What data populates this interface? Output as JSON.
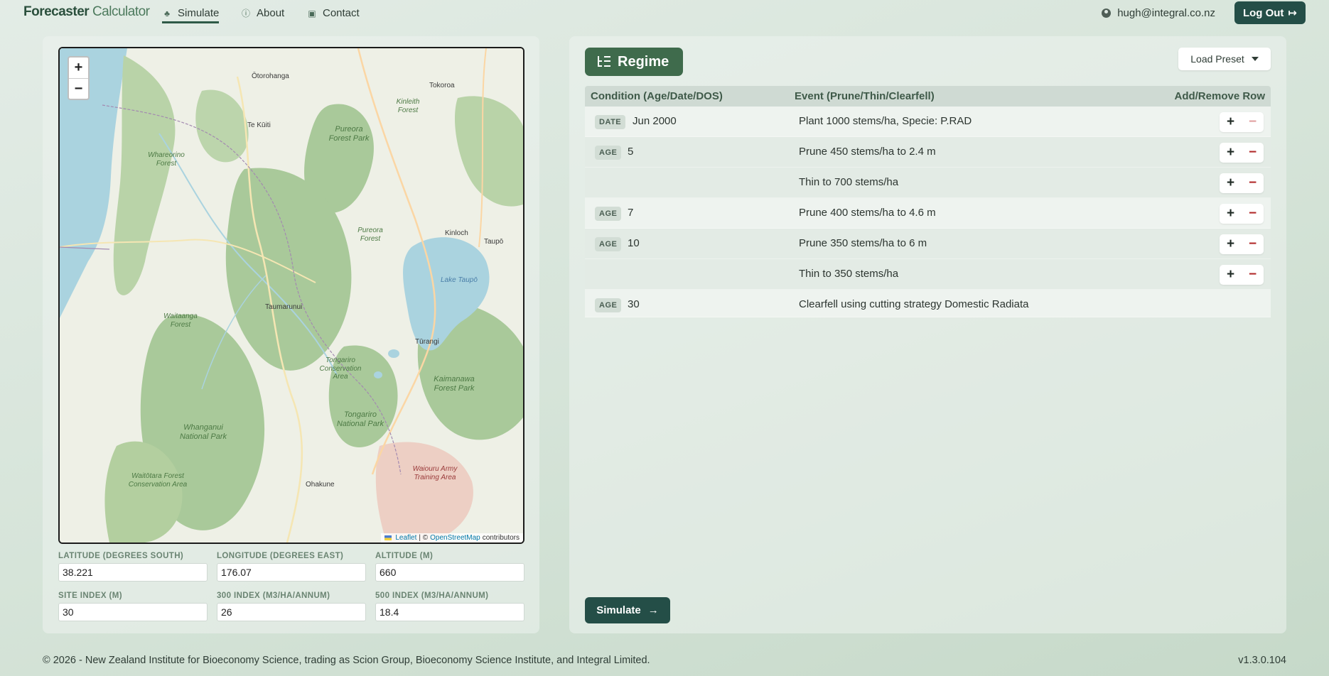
{
  "nav": {
    "brand_main": "Forecaster",
    "brand_accent": "Calculator",
    "links": [
      {
        "label": "Simulate",
        "icon": "tree-icon",
        "glyph": "♣",
        "active": true
      },
      {
        "label": "About",
        "icon": "info-icon",
        "glyph": "ⓘ",
        "active": false
      },
      {
        "label": "Contact",
        "icon": "contact-card-icon",
        "glyph": "▣",
        "active": false
      }
    ],
    "user_email": "hugh@integral.co.nz",
    "logout_label": "Log Out",
    "logout_icon": "↦"
  },
  "map": {
    "zoom_in": "+",
    "zoom_out": "−",
    "attribution": {
      "leaflet": "Leaflet",
      "separator": "| ©",
      "osm": "OpenStreetMap",
      "suffix": "contributors"
    },
    "places": {
      "otorohanga": "Ōtorohanga",
      "tokoroa": "Tokoroa",
      "kinleith": "Kinleith Forest",
      "te_kuiti": "Te Kūiti",
      "pureora_park": "Pureora Forest Park",
      "whareorino": "Whareorino Forest",
      "pureora_forest": "Pureora Forest",
      "kinloch": "Kinloch",
      "taupo": "Taupō",
      "lake_taupo": "Lake Taupō",
      "taumarunui": "Taumarunui",
      "waitaanga": "Waitaanga Forest",
      "turangi": "Tūrangi",
      "tongariro_cons": "Tongariro Conservation Area",
      "kaimanawa": "Kaimanawa Forest Park",
      "tongariro_np": "Tongariro National Park",
      "whanganui": "Whanganui National Park",
      "waiouru": "Waiouru Army Training Area",
      "waitotara": "Waitōtara Forest Conservation Area",
      "ohakune": "Ohakune"
    }
  },
  "fields": {
    "latitude": {
      "label": "Latitude (degrees south)",
      "value": "38.221"
    },
    "longitude": {
      "label": "Longitude (degrees east)",
      "value": "176.07"
    },
    "altitude": {
      "label": "Altitude (m)",
      "value": "660"
    },
    "site_index": {
      "label": "Site Index (m)",
      "value": "30"
    },
    "index_300": {
      "label": "300 Index (m3/ha/annum)",
      "value": "26"
    },
    "index_500": {
      "label": "500 Index (m3/ha/annum)",
      "value": "18.4"
    }
  },
  "regime": {
    "title": "Regime",
    "load_preset": "Load Preset",
    "columns": {
      "condition": "Condition (Age/Date/DOS)",
      "event": "Event (Prune/Thin/Clearfell)",
      "actions": "Add/Remove Row"
    },
    "rows": [
      {
        "badge": "DATE",
        "value": "Jun 2000",
        "event": "Plant 1000 stems/ha, Specie: P.RAD"
      },
      {
        "badge": "AGE",
        "value": "5",
        "event": "Prune 450 stems/ha to 2.4 m"
      },
      {
        "badge": "",
        "value": "",
        "event": "Thin to 700 stems/ha"
      },
      {
        "badge": "AGE",
        "value": "7",
        "event": "Prune 400 stems/ha to 4.6 m"
      },
      {
        "badge": "AGE",
        "value": "10",
        "event": "Prune 350 stems/ha to 6 m"
      },
      {
        "badge": "",
        "value": "",
        "event": "Thin to 350 stems/ha"
      },
      {
        "badge": "AGE",
        "value": "30",
        "event": "Clearfell using cutting strategy Domestic Radiata"
      }
    ],
    "add_glyph": "+",
    "remove_glyph": "−",
    "simulate_label": "Simulate",
    "simulate_icon": "→"
  },
  "footer": {
    "copyright": "© 2026 - New Zealand Institute for Bioeconomy Science, trading as Scion Group, Bioeconomy Science Institute, and Integral Limited.",
    "version": "v1.3.0.104"
  },
  "colors": {
    "primary": "#244e47",
    "regime_tab": "#3f6b4c",
    "remove_red": "#b12a2a",
    "forest_green": "#a9c99a",
    "lake_blue": "#aad3df"
  }
}
